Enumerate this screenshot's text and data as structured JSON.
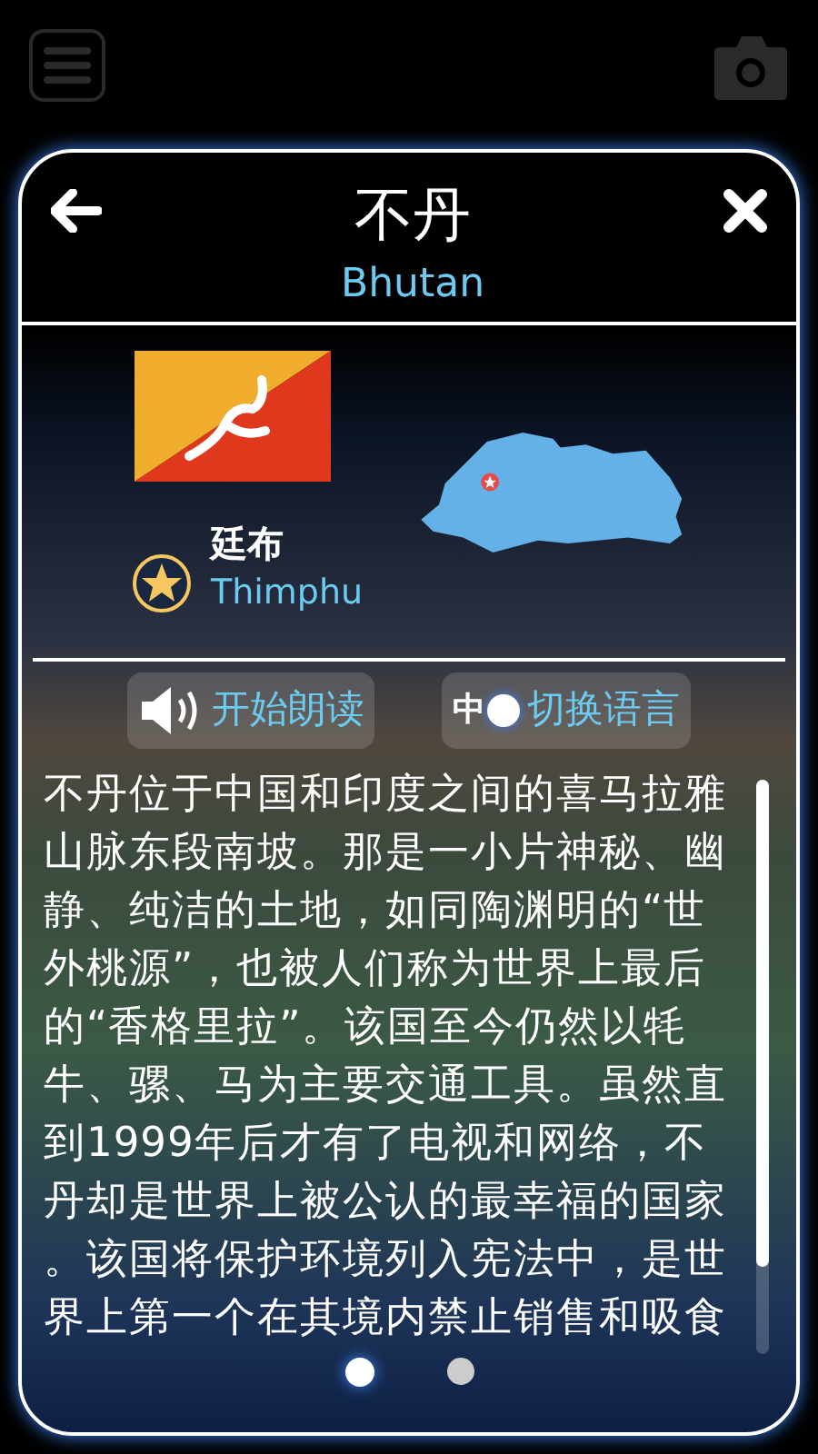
{
  "header": {
    "title": "不丹",
    "subtitle": "Bhutan"
  },
  "capital": {
    "name": "廷布",
    "name_en": "Thimphu"
  },
  "actions": [
    {
      "kind": "read",
      "label": "开始朗读"
    },
    {
      "kind": "language",
      "label": "切换语言",
      "badge": "中"
    }
  ],
  "description": {
    "lines": [
      "不丹位于中国和印度之间的喜马拉雅",
      "山脉东段南坡。那是一小片神秘、幽",
      "静、纯洁的土地，如同陶渊明的“世",
      "外桃源”，也被人们称为世界上最后",
      "的“香格里拉”。该国至今仍然以牦",
      "牛、骡、马为主要交通工具。虽然直",
      "到1999年后才有了电视和网络，不",
      "丹却是世界上被公认的最幸福的国家",
      "。该国将保护环境列入宪法中，是世",
      "界上第一个在其境内禁止销售和吸食"
    ]
  },
  "pages": [
    {
      "selected": true
    },
    {
      "selected": false
    }
  ]
}
